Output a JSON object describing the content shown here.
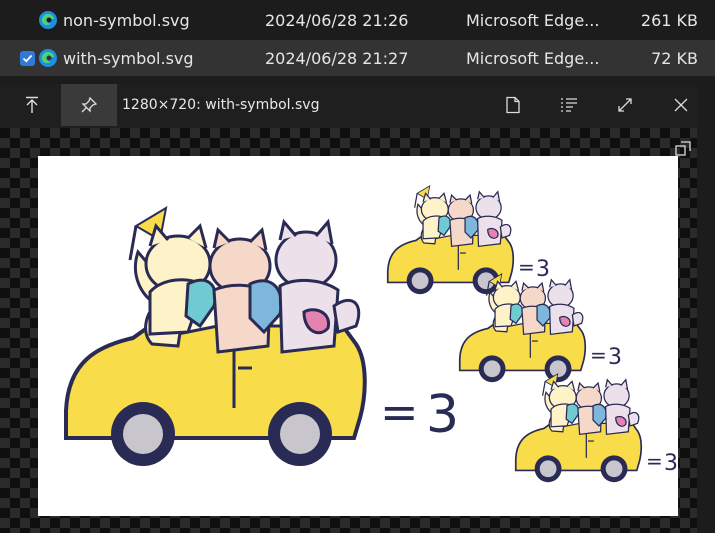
{
  "files": [
    {
      "name": "non-symbol.svg",
      "date": "2024/06/28 21:26",
      "type": "Microsoft Edge...",
      "size": "261 KB",
      "selected": false
    },
    {
      "name": "with-symbol.svg",
      "date": "2024/06/28 21:27",
      "type": "Microsoft Edge...",
      "size": "72 KB",
      "selected": true
    }
  ],
  "viewer": {
    "title": "1280×720: with-symbol.svg",
    "icons": [
      "pin-top-icon",
      "pin-icon",
      "file-icon",
      "list-icon",
      "maximize-icon",
      "close-icon"
    ]
  },
  "image": {
    "equation_symbol": "=",
    "equation_value": "3",
    "colors": {
      "car": "#f8dc4a",
      "cat1": "#fdf2c8",
      "cat2": "#f6d8c9",
      "cat3": "#ece0ea",
      "bag1": "#6fcad1",
      "bag2": "#7fb7dc",
      "bag3": "#e583b0",
      "outline": "#2a2b55",
      "wheel": "#c8c6cc"
    }
  }
}
